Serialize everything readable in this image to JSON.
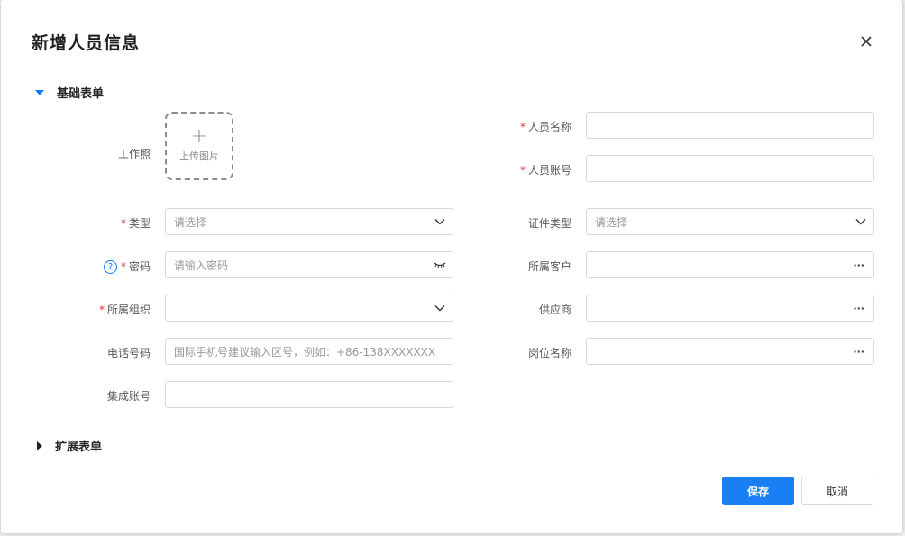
{
  "dialog": {
    "title": "新增人员信息",
    "close_icon": "close-icon"
  },
  "sections": {
    "basic": {
      "label": "基础表单",
      "state": "expanded"
    },
    "extended": {
      "label": "扩展表单",
      "state": "collapsed"
    }
  },
  "upload": {
    "label": "工作照",
    "text": "上传图片",
    "icon": "plus-icon"
  },
  "fields": {
    "person_name": {
      "label": "人员名称",
      "required": "*",
      "value": ""
    },
    "person_account": {
      "label": "人员账号",
      "required": "*",
      "value": ""
    },
    "type": {
      "label": "类型",
      "required": "*",
      "placeholder": "请选择"
    },
    "id_type": {
      "label": "证件类型",
      "placeholder": "请选择"
    },
    "password": {
      "label": "密码",
      "required": "*",
      "placeholder": "请输入密码",
      "help_glyph": "?"
    },
    "customer": {
      "label": "所属客户",
      "more": "···"
    },
    "organization": {
      "label": "所属组织",
      "required": "*",
      "value": ""
    },
    "supplier": {
      "label": "供应商",
      "more": "···"
    },
    "phone": {
      "label": "电话号码",
      "placeholder": "国际手机号建议输入区号，例如：+86-138XXXXXXX"
    },
    "position": {
      "label": "岗位名称",
      "more": "···"
    },
    "integration_account": {
      "label": "集成账号",
      "value": ""
    }
  },
  "buttons": {
    "save": "保存",
    "cancel": "取消"
  },
  "colors": {
    "primary": "#1a7ff5",
    "required": "#e03030",
    "expanded_arrow": "#1677ff"
  }
}
